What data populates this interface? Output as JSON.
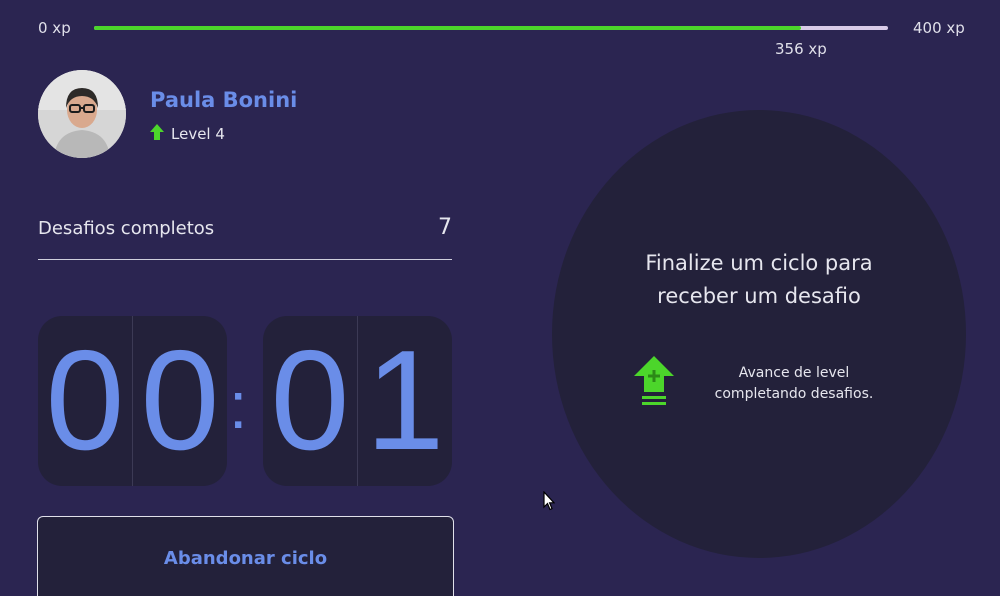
{
  "xp": {
    "min_label": "0 xp",
    "max_label": "400 xp",
    "current_label": "356 xp",
    "progress_fraction": 0.89,
    "fill_color": "#4cd62b",
    "track_color": "#d9cbe8"
  },
  "profile": {
    "name": "Paula Bonini",
    "level_label": "Level 4",
    "level_icon": "arrow-up-icon"
  },
  "challenges": {
    "label": "Desafios completos",
    "count": "7"
  },
  "countdown": {
    "minutes": [
      "0",
      "0"
    ],
    "separator": ":",
    "seconds": [
      "0",
      "1"
    ]
  },
  "actions": {
    "abandon_label": "Abandonar ciclo"
  },
  "challenge_box": {
    "title": "Finalize um ciclo para receber um desafio",
    "hint": "Avance de level completando desafios.",
    "hint_icon": "level-up-icon"
  },
  "colors": {
    "background": "#2b2551",
    "card": "#23213a",
    "accent_blue": "#6a8de8",
    "accent_green": "#4cd62b"
  }
}
